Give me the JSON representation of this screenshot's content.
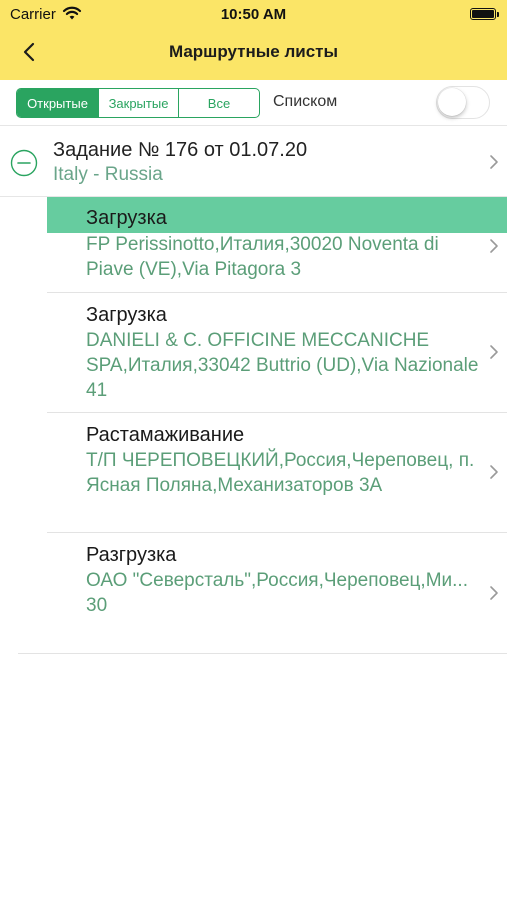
{
  "status_bar": {
    "carrier": "Carrier",
    "time": "10:50 AM"
  },
  "nav": {
    "title": "Маршрутные листы"
  },
  "filter": {
    "segments": [
      {
        "label": "Открытые",
        "selected": true
      },
      {
        "label": "Закрытые",
        "selected": false
      },
      {
        "label": "Все",
        "selected": false
      }
    ],
    "list_label": "Списком",
    "list_toggle_on": false
  },
  "task": {
    "title": "Задание № 176 от 01.07.20",
    "route": "Italy - Russia",
    "stops": [
      {
        "type": "Загрузка",
        "address": "FP Perissinotto,Италия,30020 Noventa di Piave (VE),Via Pitagora 3",
        "highlighted": true
      },
      {
        "type": "Загрузка",
        "address": "DANIELI & C. OFFICINE MECCANICHE SPA,Италия,33042 Buttrio (UD),Via Nazionale 41",
        "highlighted": false
      },
      {
        "type": "Растамаживание",
        "address": "Т/П ЧЕРЕПОВЕЦКИЙ,Россия,Череповец, п. Ясная Поляна,Механизаторов 3А",
        "highlighted": false
      },
      {
        "type": "Разгрузка",
        "address": "ОАО \"Северсталь\",Россия,Череповец,Ми... 30",
        "highlighted": false
      }
    ]
  },
  "colors": {
    "nav_bar": "#fbe567",
    "accent_green": "#2aa460",
    "highlight_row": "#66cc9f",
    "address_text": "#5b9e78"
  },
  "icons": {
    "back": "chevron-left-icon",
    "collapse": "minus-circle-icon",
    "disclosure": "chevron-right-icon",
    "wifi": "wifi-icon",
    "battery": "battery-icon"
  }
}
